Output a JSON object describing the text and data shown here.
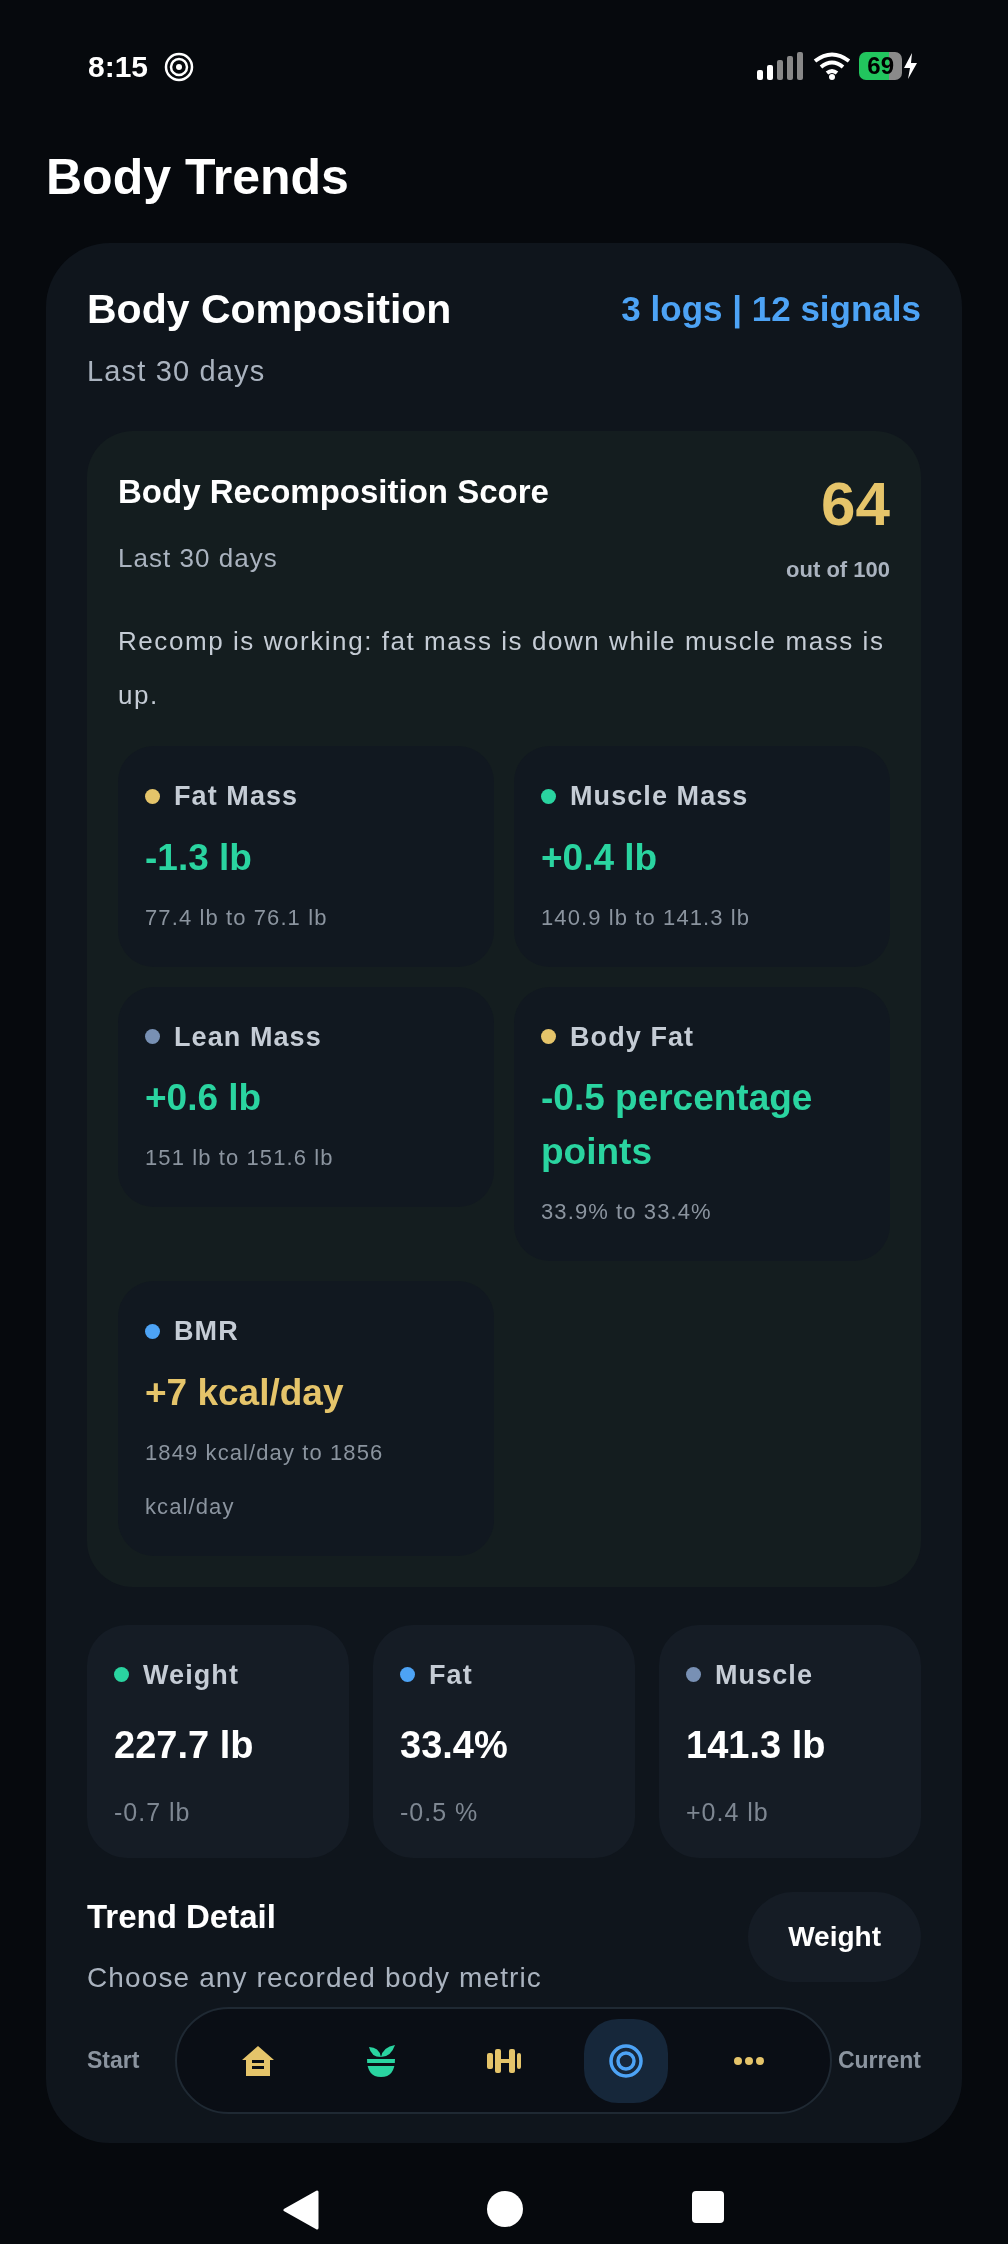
{
  "status_bar": {
    "time": "8:15",
    "battery": "69"
  },
  "title": "Body Trends",
  "composition": {
    "title": "Body Composition",
    "subtitle": "Last 30 days",
    "summary": "3 logs | 12 signals",
    "score": {
      "title": "Body Recomposition Score",
      "subtitle": "Last 30 days",
      "value": "64",
      "caption": "out of 100",
      "description": "Recomp is working: fat mass is down while muscle mass is up.",
      "metrics": [
        {
          "label": "Fat Mass",
          "color": "#e5c46a",
          "change": "-1.3 lb",
          "caution": false,
          "range": "77.4 lb to 76.1 lb"
        },
        {
          "label": "Muscle Mass",
          "color": "#2ad4a0",
          "change": "+0.4 lb",
          "caution": false,
          "range": "140.9 lb to 141.3 lb"
        },
        {
          "label": "Lean Mass",
          "color": "#7890b4",
          "change": "+0.6 lb",
          "caution": false,
          "range": "151 lb to 151.6 lb"
        },
        {
          "label": "Body Fat",
          "color": "#e5c46a",
          "change": "-0.5 percentage points",
          "caution": false,
          "range": "33.9% to 33.4%"
        },
        {
          "label": "BMR",
          "color": "#4da3f5",
          "change": "+7 kcal/day",
          "caution": true,
          "range": "1849 kcal/day to 1856 kcal/day"
        }
      ]
    },
    "stats": [
      {
        "label": "Weight",
        "color": "#2ad4a0",
        "value": "227.7 lb",
        "change": "-0.7 lb"
      },
      {
        "label": "Fat",
        "color": "#4da3f5",
        "value": "33.4%",
        "change": "-0.5 %"
      },
      {
        "label": "Muscle",
        "color": "#7890b4",
        "value": "141.3 lb",
        "change": "+0.4 lb"
      }
    ],
    "trend_detail": {
      "title": "Trend Detail",
      "subtitle": "Choose any recorded body metric",
      "metric_button": "Weight",
      "columns": [
        "Start",
        "Current"
      ]
    }
  },
  "tab_bar": [
    {
      "kind": "home",
      "selected": false
    },
    {
      "kind": "plant",
      "selected": false
    },
    {
      "kind": "dumbbell",
      "selected": false
    },
    {
      "kind": "target",
      "selected": true
    },
    {
      "kind": "more",
      "selected": false
    }
  ]
}
